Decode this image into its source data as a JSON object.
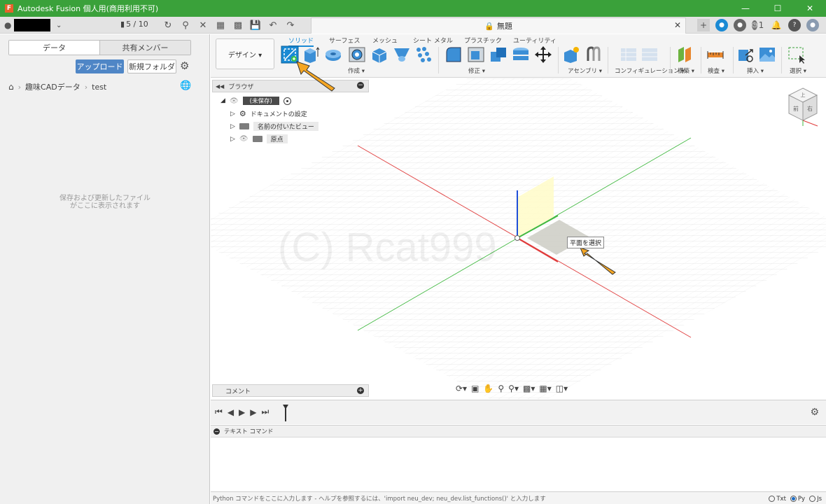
{
  "titlebar": {
    "app_title": "Autodesk Fusion 個人用(商用利用不可)",
    "app_icon_letter": "F",
    "minimize": "—",
    "maximize": "☐",
    "close": "✕"
  },
  "appbar": {
    "job_status": "5 / 10",
    "doc_title": "無題",
    "notification_count": "1"
  },
  "left_panel": {
    "tab_data": "データ",
    "tab_shared": "共有メンバー",
    "upload_label": "アップロード",
    "new_folder_label": "新規フォルダ",
    "breadcrumb": [
      "趣味CADデータ",
      "test"
    ],
    "empty_message": "保存および更新したファイル\nがここに表示されます"
  },
  "ribbon": {
    "workspace_label": "デザイン ▾",
    "tabs": [
      "ソリッド",
      "サーフェス",
      "メッシュ",
      "シート メタル",
      "プラスチック",
      "ユーティリティ"
    ],
    "groups": {
      "create": "作成 ▾",
      "modify": "修正 ▾",
      "assemble": "アセンブリ ▾",
      "configure": "コンフィギュレーション ▾",
      "construct": "構築 ▾",
      "inspect": "検査 ▾",
      "insert": "挿入 ▾",
      "select": "選択 ▾"
    }
  },
  "browser": {
    "title": "ブラウザ",
    "root_label": "(未保存)",
    "items": [
      "ドキュメントの設定",
      "名前の付いたビュー",
      "原点"
    ]
  },
  "viewport": {
    "watermark": "(C) Rcat999",
    "tooltip": "平面を選択",
    "comment_label": "コメント",
    "viewcube_top": "上",
    "viewcube_front": "前",
    "viewcube_right": "右"
  },
  "text_command": {
    "header": "テキスト コマンド",
    "input_placeholder": "Python コマンドをここに入力します - ヘルプを参照するには、'import neu_dev; neu_dev.list_functions()' と入力します",
    "options": [
      "Txt",
      "Py",
      "Js"
    ],
    "selected": "Py"
  },
  "colors": {
    "titlebar": "#3aa13a",
    "accent": "#1a8ad4",
    "upload": "#4f86c6",
    "arrow": "#f5a623"
  }
}
